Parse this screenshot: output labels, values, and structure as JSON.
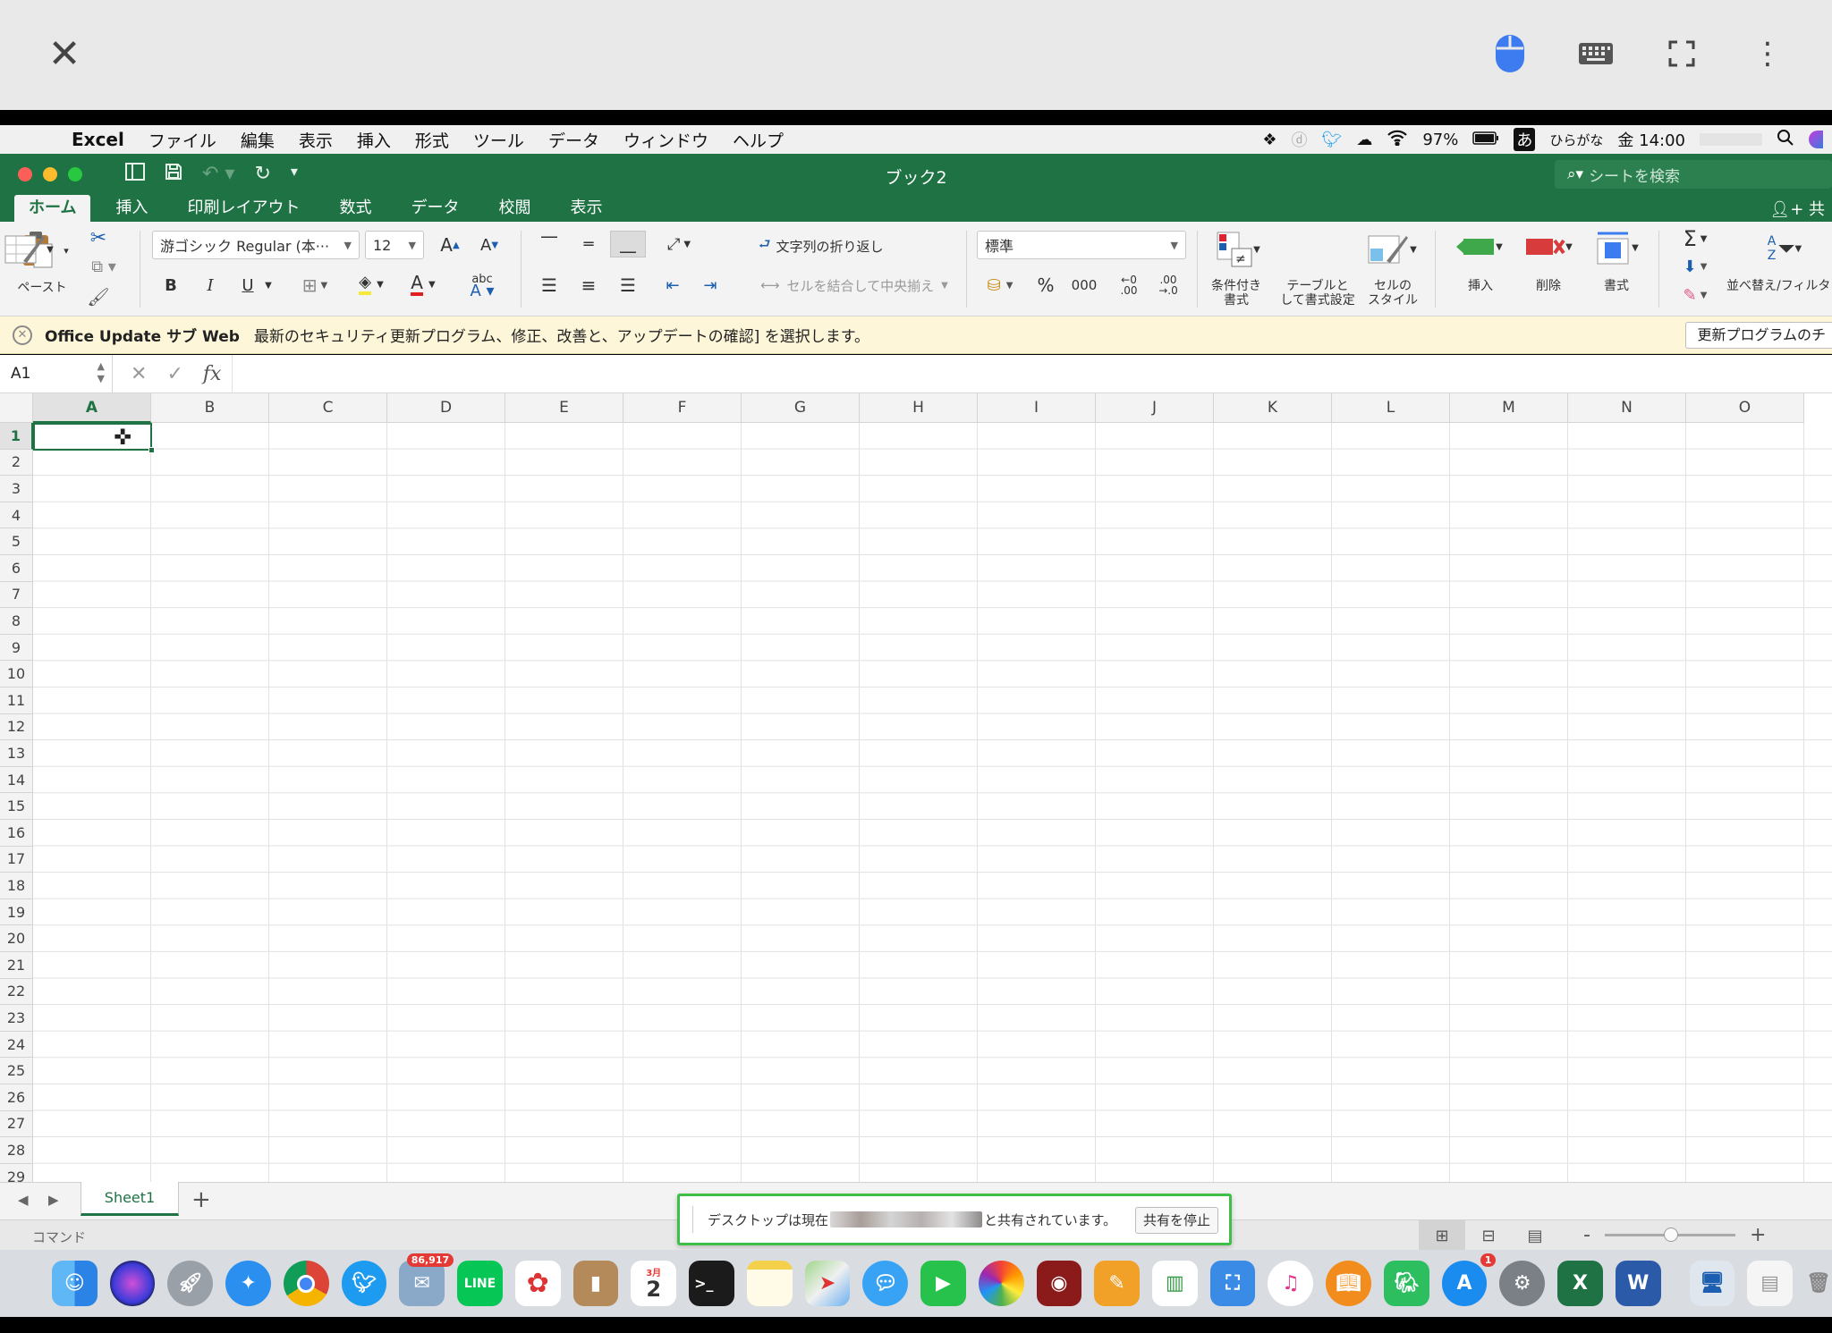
{
  "viewer": {
    "icons": [
      "close-icon",
      "mouse-icon",
      "keyboard-icon",
      "fullscreen-icon",
      "more-icon"
    ]
  },
  "menubar": {
    "app": "Excel",
    "items": [
      "ファイル",
      "編集",
      "表示",
      "挿入",
      "形式",
      "ツール",
      "データ",
      "ウィンドウ",
      "ヘルプ"
    ],
    "battery": "97%",
    "input_mode_glyph": "あ",
    "input_mode": "ひらがな",
    "clock": "金 14:00"
  },
  "titlebar": {
    "title": "ブック2",
    "search_placeholder": "シートを検索"
  },
  "tabs": [
    "ホーム",
    "挿入",
    "印刷レイアウト",
    "数式",
    "データ",
    "校閲",
    "表示"
  ],
  "share_label": "共",
  "ribbon": {
    "paste": "ペースト",
    "font_name": "游ゴシック Regular (本···",
    "font_size": "12",
    "wrap_text": "文字列の折り返し",
    "merge_center": "セルを結合して中央揃え",
    "number_format": "標準",
    "percent": "%",
    "comma": "000",
    "conditional_1": "条件付き",
    "conditional_2": "書式",
    "table_1": "テーブルと",
    "table_2": "して書式設定",
    "cellstyle_1": "セルの",
    "cellstyle_2": "スタイル",
    "insert": "挿入",
    "delete": "削除",
    "format": "書式",
    "sort_filter": "並べ替え/フィルタ",
    "bold": "B",
    "italic": "I",
    "underline": "U"
  },
  "message_bar": {
    "title": "Office Update サブ Web",
    "text": "最新のセキュリティ更新プログラム、修正、改善と、アップデートの確認] を選択します。",
    "button": "更新プログラムのチ"
  },
  "formula_bar": {
    "name_box": "A1",
    "fx": "fx"
  },
  "grid": {
    "columns": [
      "A",
      "B",
      "C",
      "D",
      "E",
      "F",
      "G",
      "H",
      "I",
      "J",
      "K",
      "L",
      "M",
      "N",
      "O"
    ],
    "rows": [
      "1",
      "2",
      "3",
      "4",
      "5",
      "6",
      "7",
      "8",
      "9",
      "10",
      "11",
      "12",
      "13",
      "14",
      "15",
      "16",
      "17",
      "18",
      "19",
      "20",
      "21",
      "22",
      "23",
      "24",
      "25",
      "26",
      "27",
      "28",
      "29"
    ],
    "active_cell": "A1"
  },
  "sheets": [
    "Sheet1"
  ],
  "status": {
    "mode": "コマンド",
    "zoom_minus": "-",
    "zoom_plus": "+"
  },
  "share_notice": {
    "prefix": "デスクトップは現在",
    "suffix": "と共有されています。",
    "button": "共有を停止"
  },
  "dock": {
    "mail_badge": "86,917",
    "appstore_badge": "1",
    "calendar_day": "2",
    "calendar_month": "3月"
  },
  "colors": {
    "excel_green": "#1f7244",
    "message_bg": "#fdf6d8",
    "share_border": "#3fbf48"
  }
}
